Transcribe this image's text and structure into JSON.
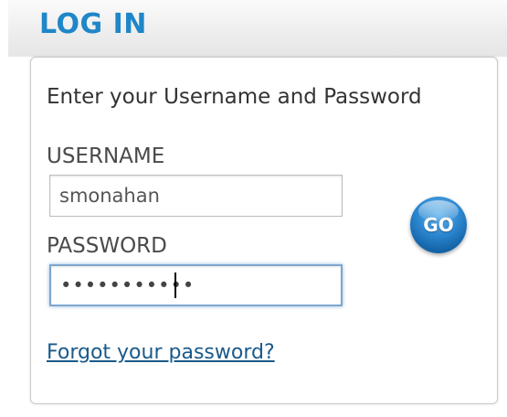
{
  "header": {
    "title": "LOG IN"
  },
  "form": {
    "instructions": "Enter your Username and Password",
    "username_label": "USERNAME",
    "username_value": "smonahan",
    "password_label": "PASSWORD",
    "password_value": "•••••••••••",
    "go_label": "GO",
    "forgot_link": "Forgot your password?"
  },
  "colors": {
    "accent": "#1f86c8",
    "link": "#1a5a8a",
    "focus_ring": "#7ea6cf"
  }
}
